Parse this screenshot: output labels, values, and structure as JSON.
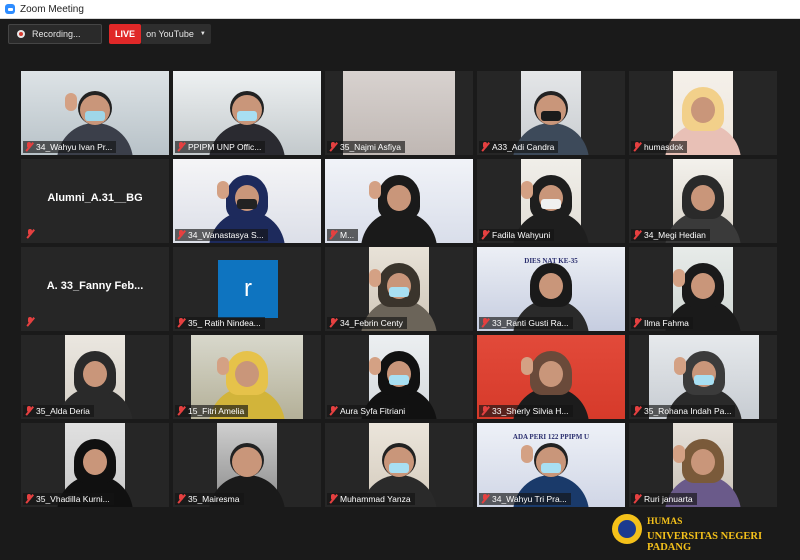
{
  "window": {
    "title": "Zoom Meeting"
  },
  "toolbar": {
    "recording_label": "Recording...",
    "live_label": "LIVE",
    "youtube_label": "on YouTube"
  },
  "participants": [
    "34_Wahyu Ivan Pr...",
    "PPIPM UNP Offic...",
    "35_Najmi Asfiya",
    "A33_Adi Candra",
    "humasdok",
    "Alumni_A.31__BG",
    "34_Wanastasya S...",
    "M...",
    "Fadila Wahyuni",
    "34_Megi Hedian",
    "A. 33_Fanny Feb...",
    "35_ Ratih Nindea...",
    "34_Febrin Centy",
    "33_Ranti Gusti Ra...",
    "Ilma Fahma",
    "35_Alda Deria",
    "15_Fitri Amelia",
    "Aura Syfa Fitriani",
    "33_Sherly Silvia H...",
    "35_Rohana Indah Pa...",
    "35_Vhadilla Kurni...",
    "35_Mairesma",
    "Muhammad Yanza",
    "34_Wahyu Tri Pra...",
    "Ruri januarta"
  ],
  "avatar_letter": "r",
  "banners": {
    "dies": "DIES NAT   KE-35",
    "prada": "PRADA PERIC        PPIPM UNP",
    "ke35": "KE-35",
    "pipm": "ADA PERI   122 PPIPM U"
  },
  "watermark": {
    "line1": "HUMAS",
    "line2": "UNIVERSITAS NEGERI PADANG"
  },
  "colors": {
    "live": "#e02828",
    "active_speaker": "#a2d14b",
    "muted_icon": "#e54040",
    "brand": "#f4c11a"
  }
}
